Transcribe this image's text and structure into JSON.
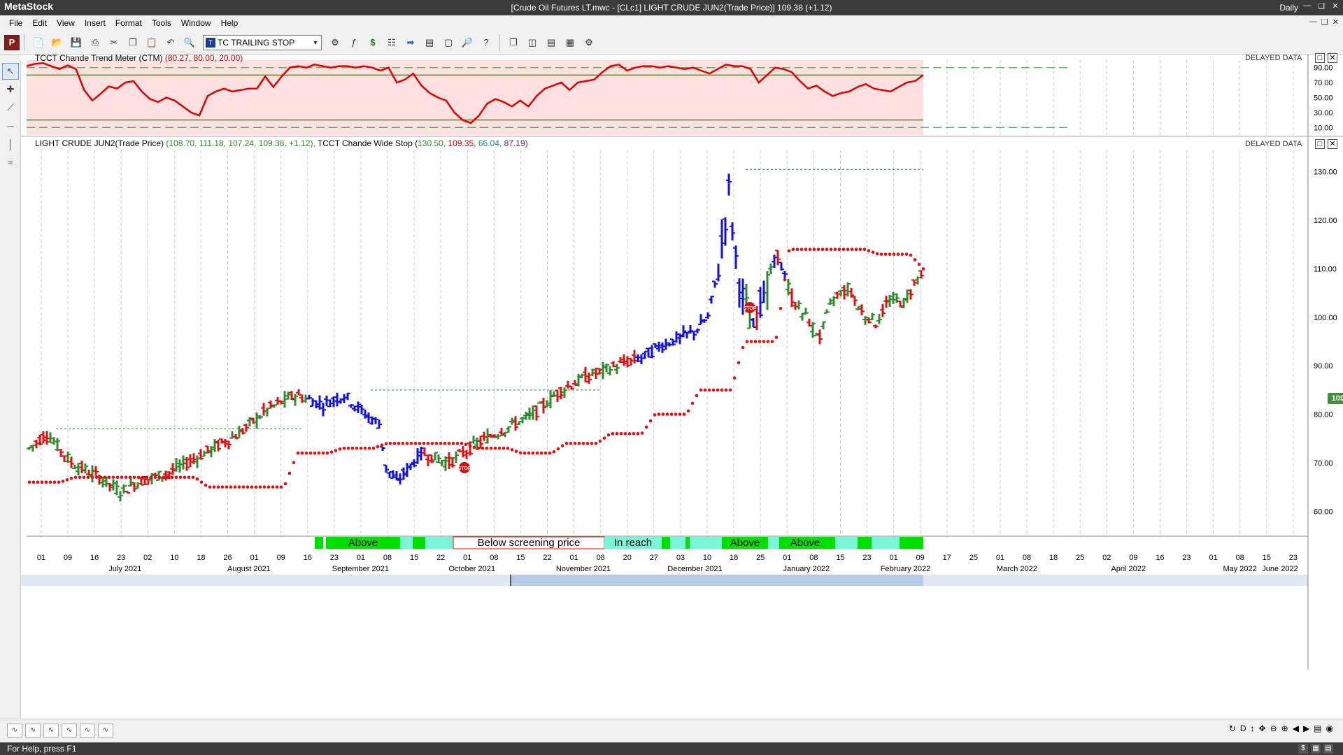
{
  "app": {
    "name": "MetaStock",
    "document_title": "[Crude Oil Futures LT.mwc - [CLc1] LIGHT CRUDE JUN2(Trade Price)]   109.38 (+1.12)",
    "periodicity": "Daily"
  },
  "menu": [
    "File",
    "Edit",
    "View",
    "Insert",
    "Format",
    "Tools",
    "Window",
    "Help"
  ],
  "toolbar": {
    "logo": "P",
    "expert_combo": "TC TRAILING STOP",
    "expert_combo_icon": "T"
  },
  "panes": {
    "indicator": {
      "title": "TCCT Chande Trend Meter (CTM)",
      "values_label": "(80.27, 80.00, 20.00)",
      "delayed": "DELAYED DATA",
      "levels": [
        80,
        20
      ],
      "dash_levels": [
        90,
        10
      ],
      "axis_ticks": [
        "90.00",
        "70.00",
        "50.00",
        "30.00",
        "10.00"
      ]
    },
    "price": {
      "title": "LIGHT CRUDE JUN2(Trade Price)",
      "values_label": "(108.70, 111.18, 107.24, 109.38, +1.12),",
      "stop_title": "TCCT Chande Wide Stop",
      "stop_values": {
        "v1": "130.50,",
        "v2": "109.35,",
        "v3": "66.04,",
        "v4": "87.19)",
        "open": "("
      },
      "delayed": "DELAYED DATA",
      "axis_ticks": [
        "130.00",
        "120.00",
        "110.00",
        "100.00",
        "90.00",
        "80.00",
        "70.00",
        "60.00"
      ],
      "last_price": "109.38",
      "stop_label": "STOP"
    }
  },
  "zone_strip": [
    {
      "label": "Above",
      "color": "#00e000"
    },
    {
      "label": "Below screening price",
      "color": "#ffffff"
    },
    {
      "label": "In reach",
      "color": "#7af5d8"
    },
    {
      "label": "Above",
      "color": "#00e000"
    },
    {
      "label": "Above",
      "color": "#00e000"
    }
  ],
  "x_axis": {
    "day_labels": [
      "01",
      "09",
      "16",
      "23",
      "02",
      "10",
      "18",
      "26",
      "01",
      "09",
      "16",
      "23",
      "01",
      "08",
      "15",
      "22",
      "01",
      "08",
      "15",
      "22",
      "01",
      "08",
      "20",
      "27",
      "03",
      "10",
      "18",
      "25",
      "01",
      "08",
      "15",
      "23",
      "01",
      "09",
      "17",
      "25",
      "01",
      "08",
      "18",
      "25",
      "02",
      "09",
      "16",
      "23",
      "01",
      "08",
      "15",
      "23"
    ],
    "month_labels": [
      "July 2021",
      "August 2021",
      "September 2021",
      "October 2021",
      "November 2021",
      "December 2021",
      "January 2022",
      "February 2022",
      "March 2022",
      "April 2022",
      "May 2022",
      "June 2022"
    ]
  },
  "colors": {
    "up_bar": "#2e8b2e",
    "down_bar": "#e01010",
    "trend_bar": "#1010e0",
    "stop_dots": "#e01010",
    "ctm_line": "#e00000",
    "ctm_fill": "#ffe0e0",
    "level_line": "#2e9a2e"
  },
  "bottom": {
    "nav_mode": "D"
  },
  "status": {
    "help": "For Help, press F1"
  },
  "chart_data": [
    {
      "type": "line",
      "title": "TCCT Chande Trend Meter (CTM)",
      "ylim": [
        0,
        100
      ],
      "series": [
        {
          "name": "CTM",
          "values": [
            92,
            95,
            96,
            92,
            88,
            93,
            88,
            60,
            46,
            55,
            65,
            62,
            70,
            72,
            58,
            48,
            44,
            50,
            46,
            38,
            30,
            26,
            52,
            58,
            62,
            58,
            60,
            62,
            62,
            78,
            64,
            78,
            90,
            92,
            90,
            94,
            92,
            90,
            92,
            92,
            90,
            92,
            90,
            86,
            90,
            70,
            74,
            82,
            66,
            56,
            50,
            46,
            30,
            20,
            16,
            26,
            42,
            48,
            44,
            38,
            46,
            38,
            52,
            62,
            66,
            70,
            60,
            70,
            72,
            74,
            84,
            92,
            94,
            86,
            90,
            92,
            92,
            90,
            92,
            90,
            88,
            90,
            86,
            82,
            88,
            94,
            92,
            92,
            88,
            70,
            80,
            90,
            88,
            84,
            72,
            62,
            66,
            58,
            52,
            56,
            58,
            64,
            68,
            62,
            60,
            58,
            64,
            70,
            72,
            80
          ]
        }
      ]
    },
    {
      "type": "bar",
      "title": "LIGHT CRUDE JUN2(Trade Price)",
      "ylim": [
        55,
        134
      ],
      "trailing_stop_levels": [
        66,
        67,
        67,
        67,
        65,
        65,
        72,
        73,
        74,
        74,
        73,
        72,
        74,
        76,
        80,
        85,
        95,
        114,
        114,
        113,
        110
      ]
    }
  ]
}
